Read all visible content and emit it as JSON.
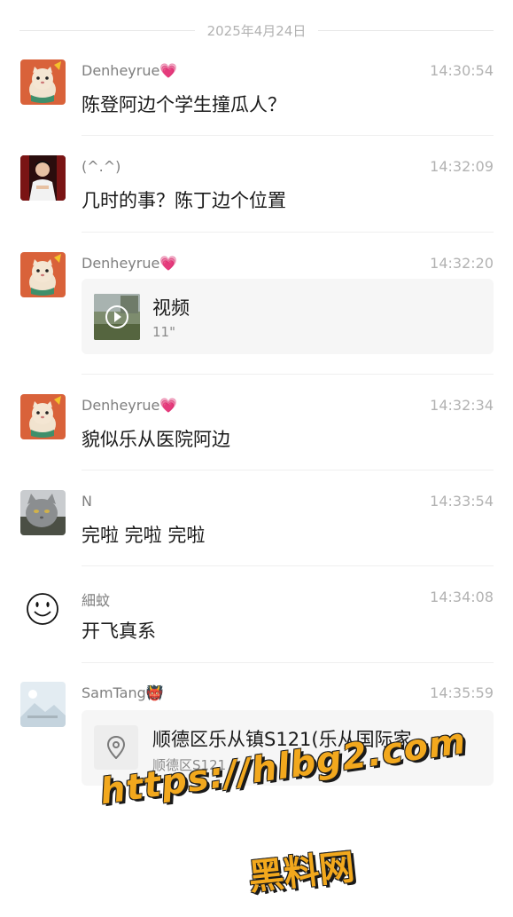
{
  "date_separator": "2025年4月24日",
  "messages": [
    {
      "sender": "Denheyrue💗",
      "time": "14:30:54",
      "text": "陈登阿边个学生撞瓜人？",
      "avatar": "cat-avatar"
    },
    {
      "sender": "(^.^)",
      "time": "14:32:09",
      "text": "几时的事？陈丁边个位置",
      "avatar": "person-avatar"
    },
    {
      "sender": "Denheyrue💗",
      "time": "14:32:20",
      "avatar": "cat-avatar",
      "video": {
        "label": "视频",
        "duration": "11\""
      }
    },
    {
      "sender": "Denheyrue💗",
      "time": "14:32:34",
      "text": "貌似乐从医院阿边",
      "avatar": "cat-avatar"
    },
    {
      "sender": "N",
      "time": "14:33:54",
      "text": "完啦 完啦 完啦",
      "avatar": "gray-cat-avatar"
    },
    {
      "sender": "細蚊",
      "time": "14:34:08",
      "text": "开飞真系",
      "avatar": "smiley-avatar"
    },
    {
      "sender": "SamTang👹",
      "time": "14:35:59",
      "avatar": "landscape-avatar",
      "location": {
        "title": "顺德区乐从镇S121(乐从国际家…",
        "subtitle": "顺德区S121"
      }
    }
  ],
  "watermark": {
    "url": "https://hlbg2.com",
    "name": "黑料网"
  },
  "colors": {
    "accent_watermark": "#f2a81d",
    "secondary_text": "#7f7f7f",
    "time_text": "#b2b2b2",
    "card_bg": "#f6f6f6"
  }
}
